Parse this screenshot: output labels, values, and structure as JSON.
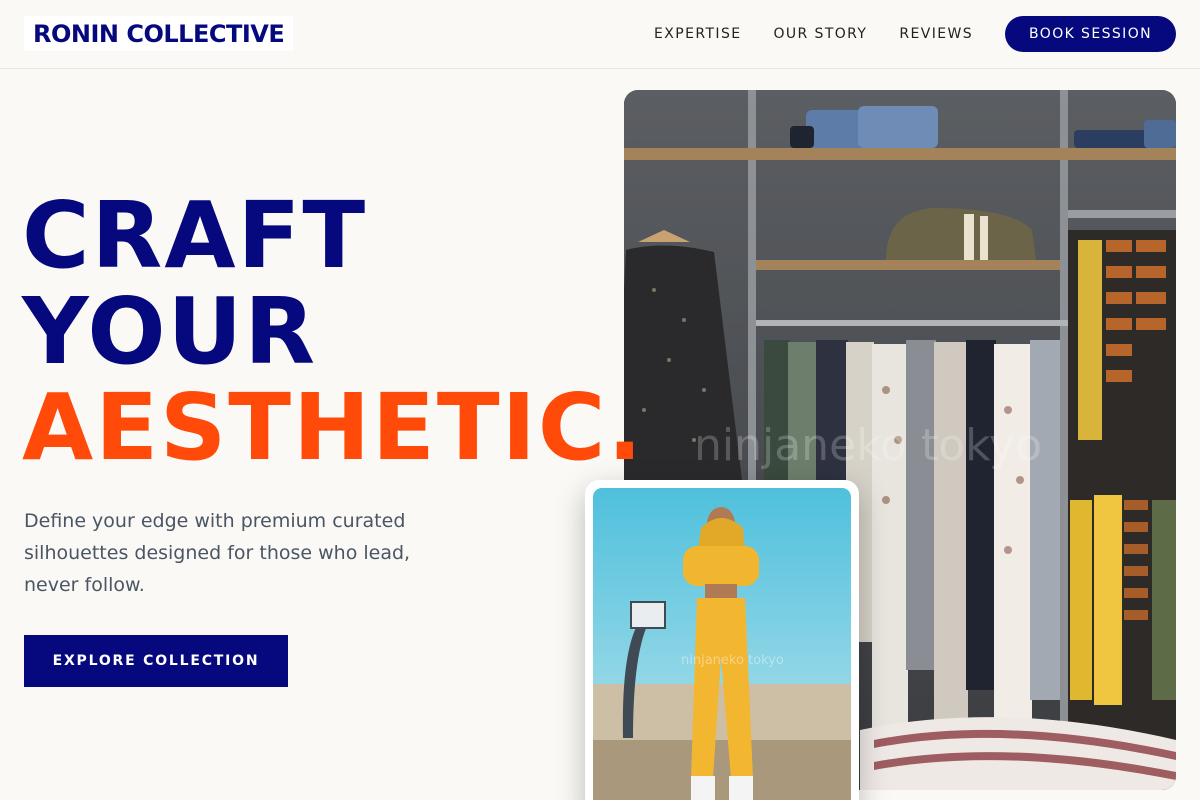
{
  "brand": {
    "name": "RONIN COLLECTIVE"
  },
  "nav": {
    "links": [
      "EXPERTISE",
      "OUR STORY",
      "REVIEWS"
    ],
    "cta": "BOOK SESSION"
  },
  "hero": {
    "line1": "CRAFT",
    "line2": "YOUR",
    "line3": "AESTHETIC",
    "period": ".",
    "subtitle": "Define your edge with premium curated silhouettes designed for those who lead, never follow.",
    "cta": "EXPLORE COLLECTION"
  },
  "images": {
    "main_watermark": "ninjaneko tokyo",
    "secondary_watermark": "ninjaneko tokyo"
  },
  "colors": {
    "brand_navy": "#06087e",
    "accent_orange": "#ff4a0a",
    "background": "#faf9f6",
    "body_text": "#4b5563"
  }
}
